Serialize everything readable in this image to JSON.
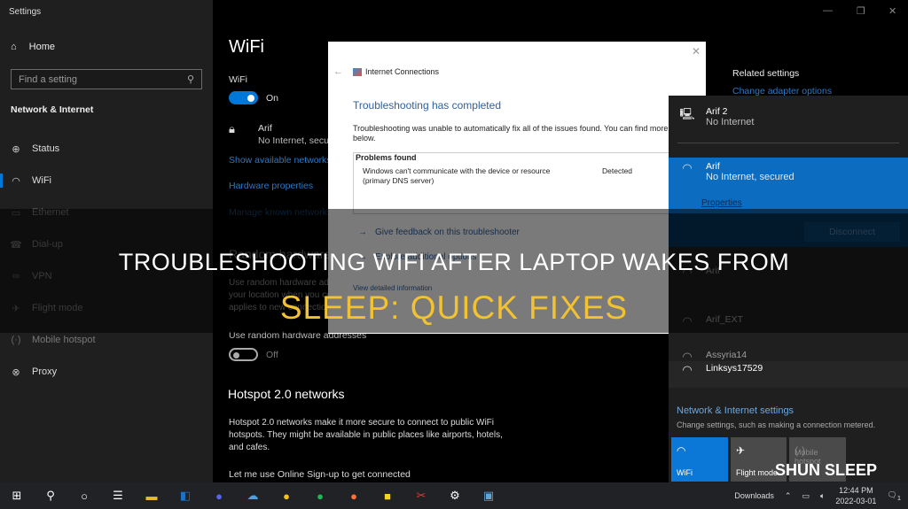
{
  "window": {
    "app_title": "Settings",
    "controls": {
      "minimize": "—",
      "maximize": "❐",
      "close": "✕"
    }
  },
  "sidebar": {
    "home_label": "Home",
    "search_placeholder": "Find a setting",
    "section_title": "Network & Internet",
    "items": [
      {
        "label": "Status",
        "icon": "status-icon",
        "glyph": "⊕"
      },
      {
        "label": "WiFi",
        "icon": "wifi-icon",
        "glyph": "⌔",
        "active": true
      },
      {
        "label": "Ethernet",
        "icon": "ethernet-icon",
        "glyph": "▭"
      },
      {
        "label": "Dial-up",
        "icon": "dialup-icon",
        "glyph": "☎"
      },
      {
        "label": "VPN",
        "icon": "vpn-icon",
        "glyph": "∞"
      },
      {
        "label": "Flight mode",
        "icon": "airplane-icon",
        "glyph": "✈"
      },
      {
        "label": "Mobile hotspot",
        "icon": "hotspot-icon",
        "glyph": "((·))"
      },
      {
        "label": "Proxy",
        "icon": "globe-icon",
        "glyph": "🌐"
      }
    ]
  },
  "main": {
    "title": "WiFi",
    "wifi_label": "WiFi",
    "wifi_toggle": "On",
    "network_name": "Arif",
    "network_status": "No Internet, secured",
    "show_networks": "Show available networks",
    "hardware_props": "Hardware properties",
    "manage_known": "Manage known networks",
    "random_hw_title": "Random hardware addresses",
    "random_hw_desc": [
      "Use random hardware addresses to make it harder for people to track",
      "your location when you connect to different WiFi networks. This setting",
      "applies to new connections."
    ],
    "random_hw_label": "Use random hardware addresses",
    "random_hw_toggle": "Off",
    "hotspot_title": "Hotspot 2.0 networks",
    "hotspot_desc": [
      "Hotspot 2.0 networks make it more secure to connect to public WiFi",
      "hotspots. They might be available in public places like airports, hotels,",
      "and cafes."
    ],
    "online_signup": "Let me use Online Sign-up to get connected"
  },
  "dialog": {
    "title": "Internet Connections",
    "heading": "Troubleshooting has completed",
    "message": "Troubleshooting was unable to automatically fix all of the issues found. You can find more details below.",
    "problems_header": "Problems found",
    "problem": "Windows can't communicate with the device or resource (primary DNS server)",
    "problem_status": "Detected",
    "feedback_link": "Give feedback on this troubleshooter",
    "explore_link": "Explore additional options",
    "details_link": "View detailed information"
  },
  "related": {
    "title": "Related settings",
    "link": "Change adapter options"
  },
  "flyout": {
    "networks": [
      {
        "name": "Arif 2",
        "status": "No Internet",
        "type": "ethernet"
      },
      {
        "name": "Arif",
        "status": "No Internet, secured",
        "type": "wifi",
        "selected": true,
        "properties": "Properties",
        "action": "Disconnect"
      },
      {
        "name": "Arif",
        "type": "wifi"
      },
      {
        "name": "Arif_EXT",
        "type": "wifi"
      },
      {
        "name": "Assyria14",
        "type": "wifi"
      },
      {
        "name": "Linksys17529",
        "type": "wifi"
      }
    ],
    "settings_title": "Network & Internet settings",
    "settings_desc": "Change settings, such as making a connection metered.",
    "tiles": [
      {
        "label": "WiFi",
        "active": true
      },
      {
        "label": "Flight mode",
        "active": false
      },
      {
        "label": "Mobile hotspot",
        "active": false
      }
    ]
  },
  "taskbar": {
    "apps": [
      "Start",
      "Search",
      "Cortana",
      "Task View",
      "File Explorer",
      "Outlook",
      "Discord",
      "Cloud",
      "CyberGhost",
      "Spotify",
      "Firefox",
      "Sticky Notes",
      "Snip",
      "Settings",
      "Network"
    ],
    "downloads": "Downloads",
    "time": "12:44 PM",
    "date": "2022-03-01",
    "notifications": "1"
  },
  "overlay": {
    "line1": "TROUBLESHOOTING WIFI AFTER LAPTOP WAKES FROM",
    "line2": "SLEEP: QUICK FIXES",
    "watermark": "SHUN SLEEP"
  },
  "colors": {
    "accent": "#0078d7",
    "headline_yellow": "#f2c232",
    "link_blue": "#2b78c6"
  }
}
